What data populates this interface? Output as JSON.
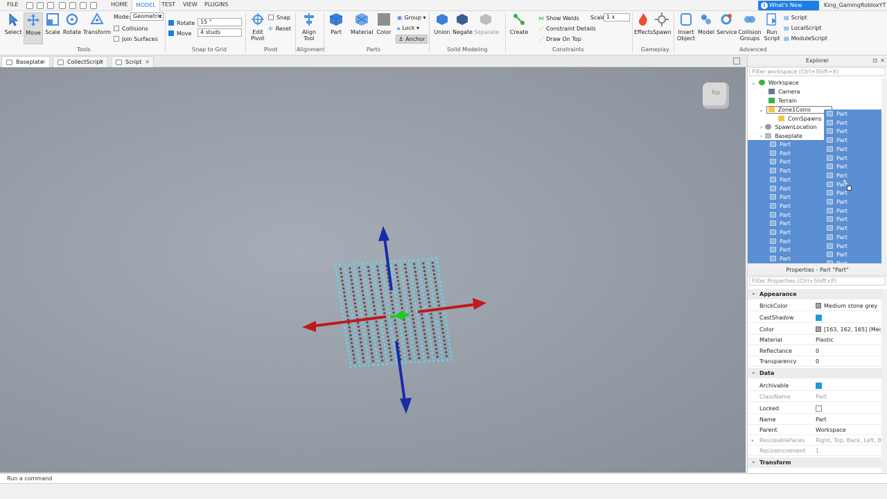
{
  "menubar": {
    "file": "FILE",
    "tabs": [
      "HOME",
      "MODEL",
      "TEST",
      "VIEW",
      "PLUGINS"
    ],
    "active_tab": "MODEL",
    "whats_new": "What's New",
    "username": "King_GamingRobloxYT"
  },
  "ribbon": {
    "tools": {
      "select": "Select",
      "move": "Move",
      "scale": "Scale",
      "rotate": "Rotate",
      "transform": "Transform",
      "label": "Tools"
    },
    "mode_label": "Mode:",
    "mode_value": "Geometric",
    "collisions": "Collisions",
    "join_surfaces": "Join Surfaces",
    "snap": {
      "rotate_label": "Rotate",
      "rotate_value": "15 °",
      "move_label": "Move",
      "move_value": "4 studs",
      "label": "Snap to Grid"
    },
    "pivot": {
      "edit": "Edit\nPivot",
      "snap": "Snap",
      "reset": "Reset",
      "label": "Pivot"
    },
    "alignment": {
      "align": "Align\nTool",
      "label": "Alignment"
    },
    "parts": {
      "part": "Part",
      "material": "Material",
      "color": "Color",
      "group": "Group",
      "lock": "Lock",
      "anchor": "Anchor",
      "label": "Parts"
    },
    "solid": {
      "union": "Union",
      "negate": "Negate",
      "separate": "Separate",
      "label": "Solid Modeling"
    },
    "constraints": {
      "create": "Create",
      "show_welds": "Show Welds",
      "details": "Constraint Details",
      "draw_on_top": "Draw On Top",
      "scale_label": "Scale",
      "scale_value": "1 x",
      "label": "Constraints"
    },
    "gameplay": {
      "effects": "Effects",
      "spawn": "Spawn",
      "label": "Gameplay"
    },
    "advanced": {
      "insert": "Insert\nObject",
      "model": "Model",
      "service": "Service",
      "groups": "Collision\nGroups",
      "run": "Run\nScript",
      "script": "Script",
      "local_script": "LocalScript",
      "module_script": "ModuleScript",
      "label": "Advanced"
    }
  },
  "doc_tabs": [
    "Baseplate",
    "CollectScript",
    "Script"
  ],
  "viewcube_label": "Top",
  "explorer": {
    "title": "Explorer",
    "filter_placeholder": "Filter workspace (Ctrl+Shift+X)",
    "items": [
      {
        "label": "Workspace",
        "icon": "globe-icon"
      },
      {
        "label": "Camera",
        "icon": "camera-icon"
      },
      {
        "label": "Terrain",
        "icon": "terrain-icon"
      },
      {
        "label": "Zone1Coins",
        "icon": "folder-icon"
      },
      {
        "label": "CoinSpawns",
        "icon": "folder-icon"
      },
      {
        "label": "SpawnLocation",
        "icon": "spawn-icon"
      },
      {
        "label": "Baseplate",
        "icon": "part-icon"
      }
    ],
    "part_label": "Part",
    "left_part_count": 14,
    "drag_part_count": 21
  },
  "properties": {
    "title": "Properties - Part \"Part\"",
    "filter_placeholder": "Filter Properties (Ctrl+Shift+P)",
    "appearance": {
      "header": "Appearance",
      "brickcolor_k": "BrickColor",
      "brickcolor_v": "Medium stone grey",
      "castshadow_k": "CastShadow",
      "color_k": "Color",
      "color_v": "[163, 162, 165] (Medi...",
      "material_k": "Material",
      "material_v": "Plastic",
      "reflectance_k": "Reflectance",
      "reflectance_v": "0",
      "transparency_k": "Transparency",
      "transparency_v": "0"
    },
    "data": {
      "header": "Data",
      "archivable_k": "Archivable",
      "classname_k": "ClassName",
      "classname_v": "Part",
      "locked_k": "Locked",
      "name_k": "Name",
      "name_v": "Part",
      "parent_k": "Parent",
      "parent_v": "Workspace",
      "faces_k": "ResizeableFaces",
      "faces_v": "Right, Top, Back, Left, B...",
      "increment_k": "ResizeIncrement",
      "increment_v": "1"
    },
    "transform_header": "Transform"
  },
  "command_bar": "Run a command",
  "colors": {
    "accent": "#1e7ee6",
    "selection": "#5b8fd3",
    "axis_x": "#c0181c",
    "axis_y": "#1b2aa8",
    "axis_z": "#22c81e",
    "coin": "#5fd6f0"
  }
}
